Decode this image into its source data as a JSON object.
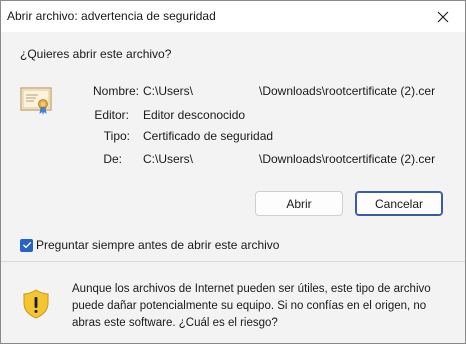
{
  "window": {
    "title": "Abrir archivo: advertencia de seguridad"
  },
  "question": "¿Quieres abrir este archivo?",
  "details": {
    "name_label": "Nombre:",
    "name_value_prefix": "C:\\Users\\",
    "name_value_suffix": "\\Downloads\\rootcertificate (2).cer",
    "publisher_label": "Editor:",
    "publisher_value": "Editor desconocido",
    "type_label": "Tipo:",
    "type_value": "Certificado de seguridad",
    "from_label": "De:",
    "from_value_prefix": "C:\\Users\\",
    "from_value_suffix": "\\Downloads\\rootcertificate (2).cer"
  },
  "buttons": {
    "open_label": "Abrir",
    "cancel_label": "Cancelar"
  },
  "checkbox": {
    "label": "Preguntar siempre antes de abrir este archivo",
    "checked": true
  },
  "warning": {
    "text": "Aunque los archivos de Internet pueden ser útiles, este tipo de archivo puede dañar potencialmente su equipo. Si no confías en el origen, no abras este software. ",
    "link_text": "¿Cuál es el riesgo?"
  },
  "colors": {
    "accent": "#2563c9",
    "shield_yellow": "#f2c531",
    "title_bar": "#ffffff",
    "dialog_bg": "#f3f3f3"
  },
  "icons": {
    "close": "close-icon",
    "certificate": "certificate-icon",
    "shield": "warning-shield-icon",
    "checkmark": "checkmark-icon"
  }
}
